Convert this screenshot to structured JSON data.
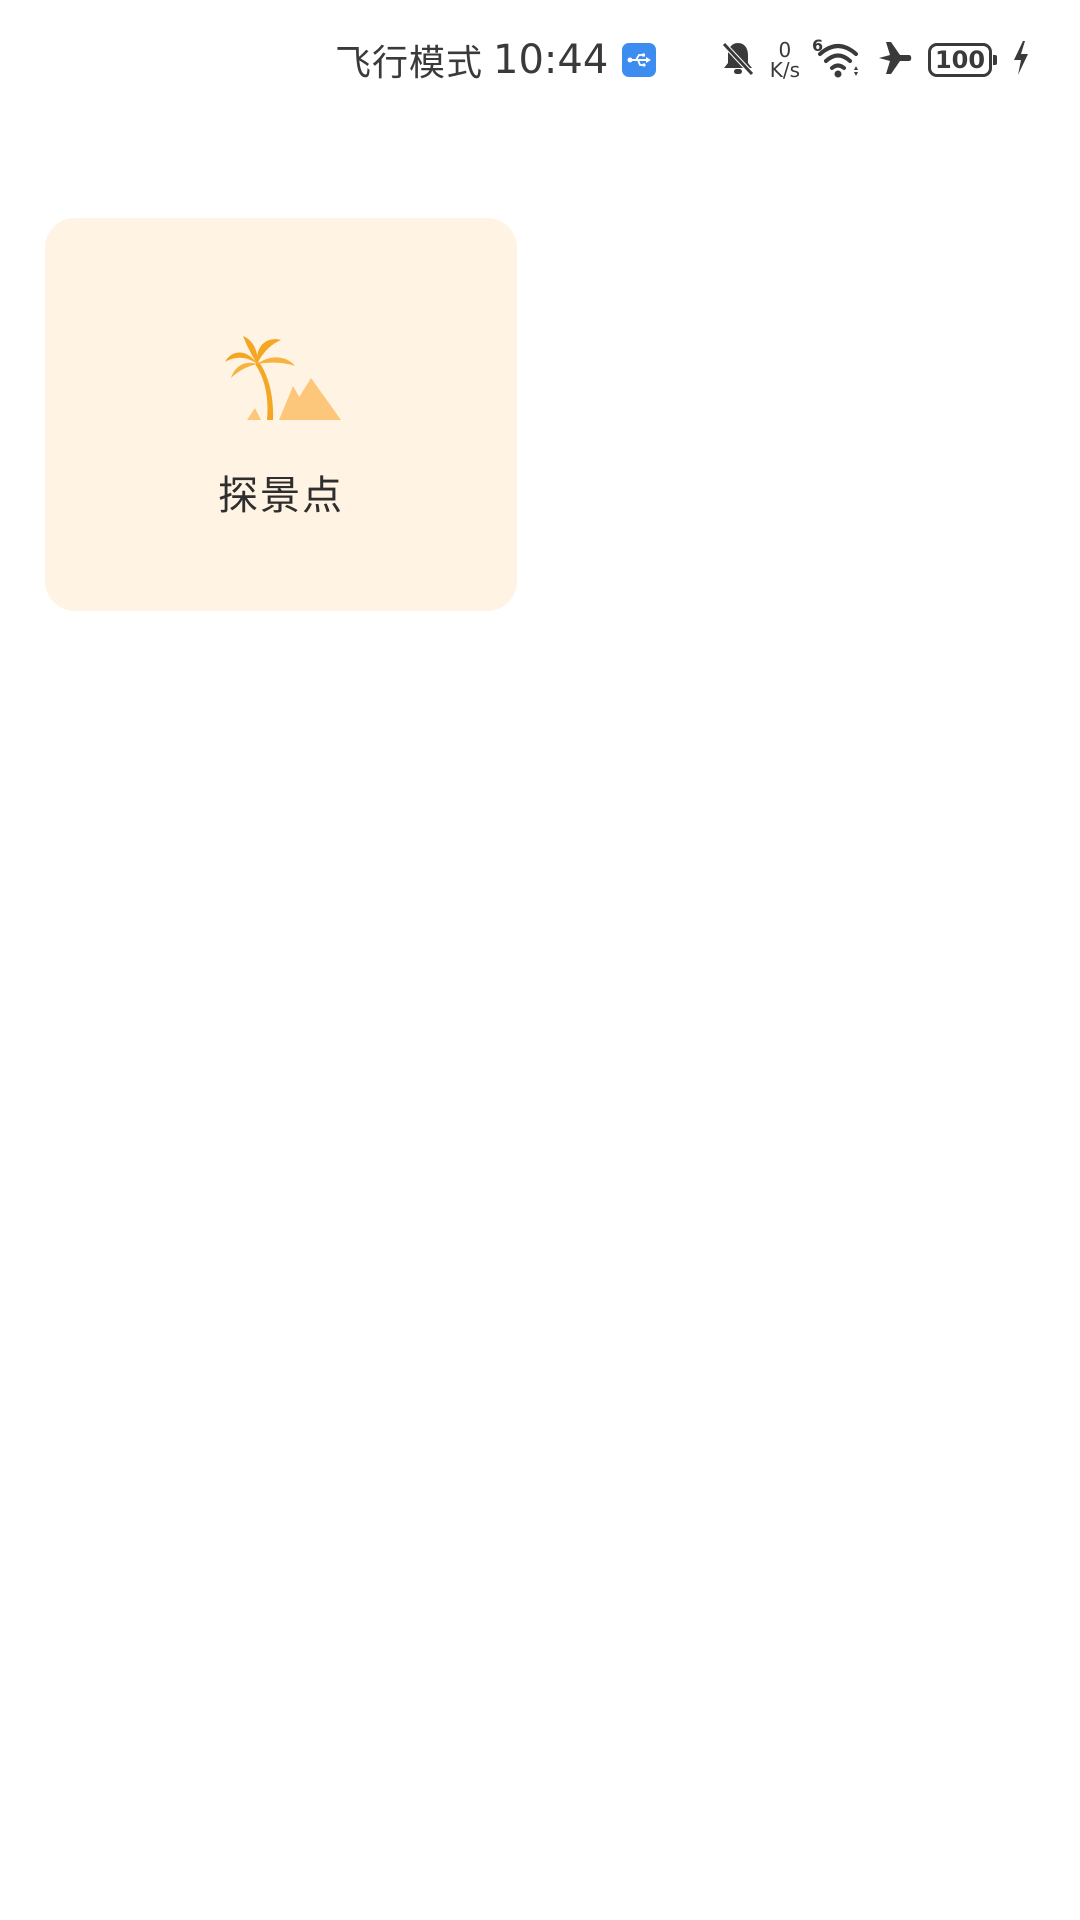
{
  "status_bar": {
    "mode": "飞行模式",
    "time": "10:44",
    "speed_value": "0",
    "speed_unit": "K/s",
    "wifi_tag": "6",
    "battery": "100",
    "icons": [
      "usb-icon",
      "bell-muted-icon",
      "wifi-icon",
      "airplane-icon",
      "battery-icon",
      "charging-icon"
    ]
  },
  "card": {
    "label": "探景点",
    "icon": "palm-tree-icon",
    "bg_color": "#fff3e3",
    "icon_colors": [
      "#f5a623",
      "#fcc77a"
    ]
  }
}
